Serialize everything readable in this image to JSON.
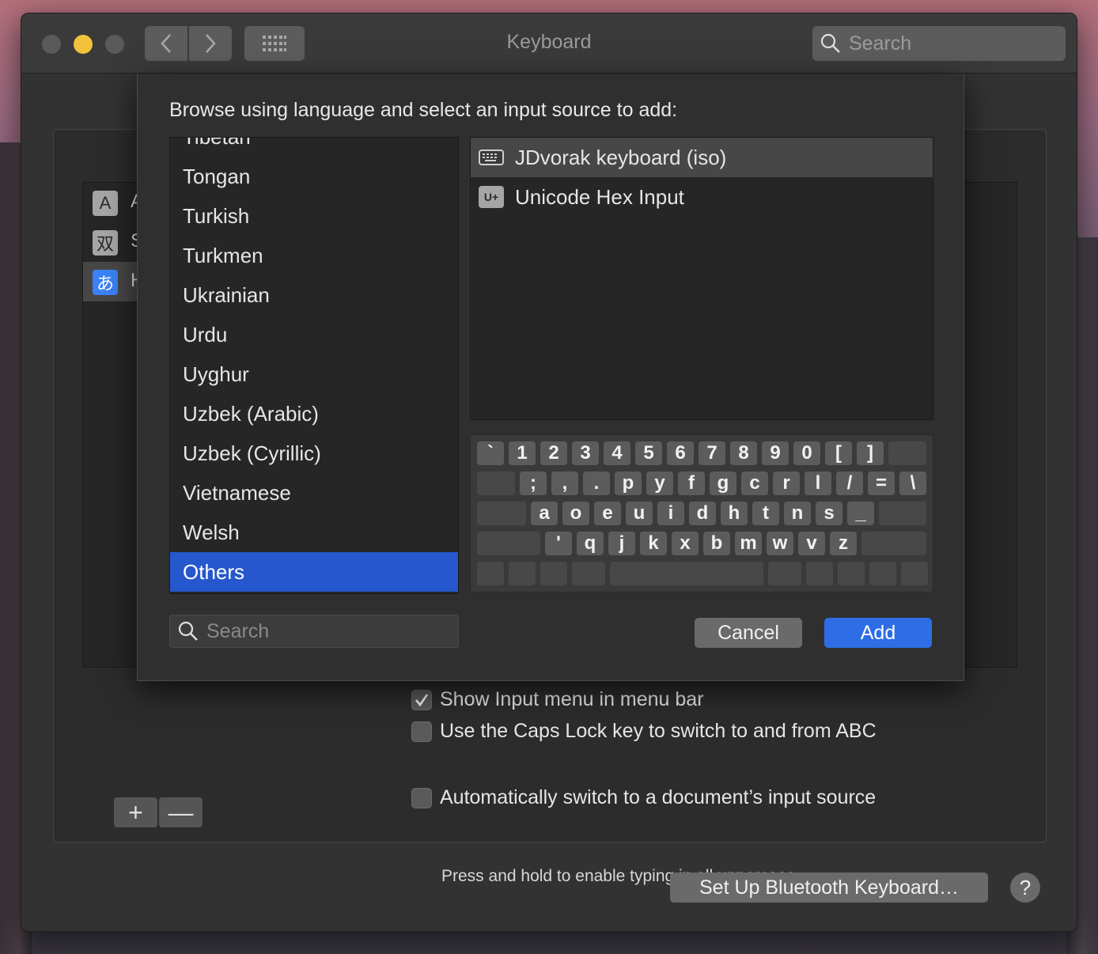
{
  "window": {
    "title": "Keyboard",
    "search_placeholder": "Search"
  },
  "input_sources": [
    {
      "icon": "A",
      "icon_style": "gray",
      "label_initial": "A"
    },
    {
      "icon": "双",
      "icon_style": "gray",
      "label_initial": "S"
    },
    {
      "icon": "あ",
      "icon_style": "blue",
      "label_initial": "H",
      "selected": true
    }
  ],
  "controls": {
    "plus": "+",
    "minus": "—"
  },
  "options": [
    {
      "label": "Show Input menu in menu bar",
      "checked": true
    },
    {
      "label": "Use the Caps Lock key to switch to and from ABC",
      "checked": false
    },
    {
      "label": "Automatically switch to a document’s input source",
      "checked": false
    }
  ],
  "caps_lock_hint": "Press and hold to enable typing in all uppercase.",
  "bluetooth_button": "Set Up Bluetooth Keyboard…",
  "help_button": "?",
  "sheet": {
    "prompt": "Browse using language and select an input source to add:",
    "languages": [
      "Tibetan",
      "Tongan",
      "Turkish",
      "Turkmen",
      "Ukrainian",
      "Urdu",
      "Uyghur",
      "Uzbek (Arabic)",
      "Uzbek (Cyrillic)",
      "Vietnamese",
      "Welsh",
      "Others"
    ],
    "selected_language": "Others",
    "sources": [
      {
        "label": "JDvorak keyboard (iso)",
        "icon": "keyboard-icon",
        "selected": true
      },
      {
        "label": "Unicode Hex Input",
        "icon": "U+",
        "selected": false
      }
    ],
    "keyboard_rows": [
      [
        "`",
        "1",
        "2",
        "3",
        "4",
        "5",
        "6",
        "7",
        "8",
        "9",
        "0",
        "[",
        "]"
      ],
      [
        ";",
        ",",
        ".",
        "p",
        "y",
        "f",
        "g",
        "c",
        "r",
        "l",
        "/",
        "=",
        "\\"
      ],
      [
        "a",
        "o",
        "e",
        "u",
        "i",
        "d",
        "h",
        "t",
        "n",
        "s",
        "_"
      ],
      [
        "'",
        "q",
        "j",
        "k",
        "x",
        "b",
        "m",
        "w",
        "v",
        "z"
      ]
    ],
    "search_placeholder": "Search",
    "cancel_label": "Cancel",
    "add_label": "Add"
  },
  "colors": {
    "accent": "#2d6ee6",
    "selection": "#2657cc",
    "minimize": "#f2c23a"
  }
}
